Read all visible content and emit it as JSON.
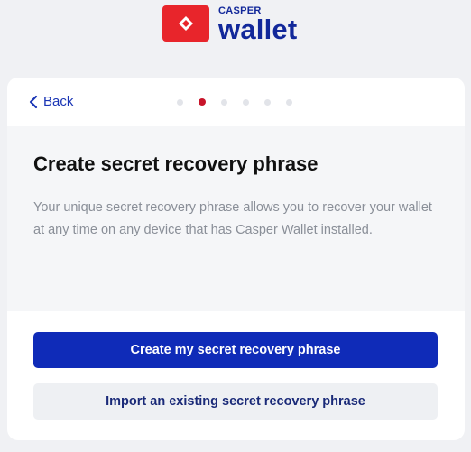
{
  "header": {
    "logo_small": "CASPER",
    "logo_big": "wallet",
    "brand_color": "#e8252b",
    "text_color": "#12289a"
  },
  "nav": {
    "back_label": "Back",
    "steps_total": 6,
    "current_step": 2
  },
  "main": {
    "title": "Create secret recovery phrase",
    "description": "Your unique secret recovery phrase allows you to recover your wallet at any time on any device that has Casper Wallet installed."
  },
  "actions": {
    "primary_label": "Create my secret recovery phrase",
    "secondary_label": "Import an existing secret recovery phrase",
    "primary_color": "#0f2bb8"
  }
}
